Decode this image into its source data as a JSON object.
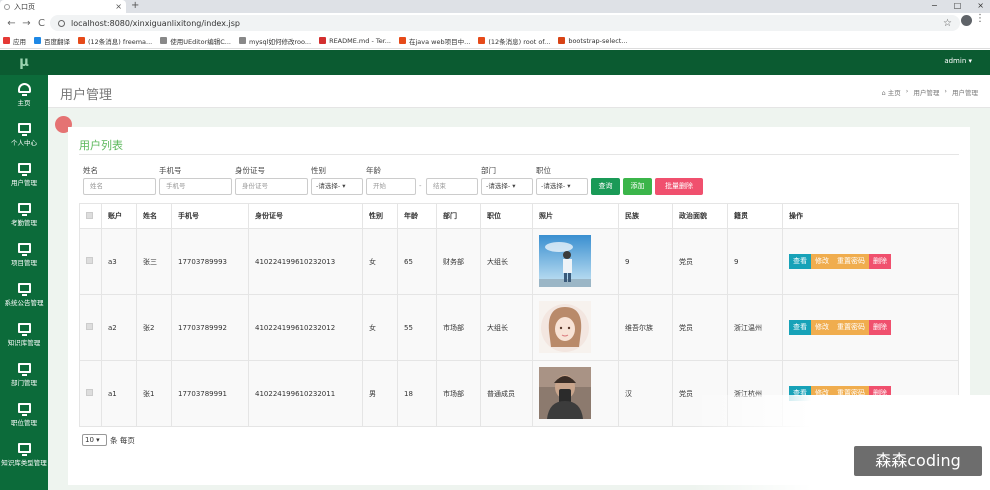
{
  "browser": {
    "tab_title": "入口页",
    "tab_close": "×",
    "new_tab": "+",
    "window_controls": [
      "−",
      "□",
      "×"
    ],
    "nav": [
      "←",
      "→",
      "C"
    ],
    "url": "localhost:8080/xinxiguanlixitong/index.jsp",
    "bookmarks": [
      {
        "label": "应用",
        "color": "#e53935"
      },
      {
        "label": "百度翻译",
        "color": "#1e88e5"
      },
      {
        "label": "(12条消息) freema...",
        "color": "#e64a19"
      },
      {
        "label": "使用UEditor编辑C...",
        "color": "#888888"
      },
      {
        "label": "mysql如何修改roo...",
        "color": "#888888"
      },
      {
        "label": "README.md - Ter...",
        "color": "#d32f2f"
      },
      {
        "label": "在java web项目中...",
        "color": "#e64a19"
      },
      {
        "label": "(12条消息) root of...",
        "color": "#e64a19"
      },
      {
        "label": "bootstrap-select...",
        "color": "#d84315"
      }
    ]
  },
  "app": {
    "logo": "μ",
    "user_menu": "admin ▾",
    "sidebar": [
      {
        "label": "主页",
        "icon": "dashboard-icon"
      },
      {
        "label": "个人中心",
        "icon": "monitor-icon"
      },
      {
        "label": "用户管理",
        "icon": "monitor-icon"
      },
      {
        "label": "考勤管理",
        "icon": "monitor-icon"
      },
      {
        "label": "项目管理",
        "icon": "monitor-icon"
      },
      {
        "label": "系统公告管理",
        "icon": "monitor-icon"
      },
      {
        "label": "知识库管理",
        "icon": "monitor-icon"
      },
      {
        "label": "部门管理",
        "icon": "monitor-icon"
      },
      {
        "label": "职位管理",
        "icon": "monitor-icon"
      },
      {
        "label": "知识库类型管理",
        "icon": "monitor-icon"
      }
    ],
    "page_title": "用户管理",
    "breadcrumb": [
      "⌂ 主页",
      "›",
      "用户管理",
      "›",
      "用户管理"
    ]
  },
  "panel": {
    "title": "用户列表",
    "filters": {
      "name_label": "姓名",
      "name_placeholder": "姓名",
      "phone_label": "手机号",
      "phone_placeholder": "手机号",
      "id_label": "身份证号",
      "id_placeholder": "身份证号",
      "gender_label": "性别",
      "gender_value": "-请选择- ▾",
      "age_label": "年龄",
      "age_start": "开始",
      "age_sep": "-",
      "age_end": "结束",
      "dept_label": "部门",
      "dept_value": "-请选择- ▾",
      "position_label": "职位",
      "position_value": "-请选择- ▾",
      "query_button": "查询",
      "add_button": "添加",
      "batch_delete_button": "批量删除"
    },
    "columns": [
      "",
      "账户",
      "姓名",
      "手机号",
      "身份证号",
      "性别",
      "年龄",
      "部门",
      "职位",
      "照片",
      "民族",
      "政治面貌",
      "籍贯",
      "操作"
    ],
    "rows": [
      {
        "account": "a3",
        "name": "张三",
        "phone": "17703789993",
        "id_no": "410224199610232013",
        "gender": "女",
        "age": "65",
        "dept": "财务部",
        "position": "大组长",
        "ethnicity": "9",
        "political": "党员",
        "origin": "9"
      },
      {
        "account": "a2",
        "name": "张2",
        "phone": "17703789992",
        "id_no": "410224199610232012",
        "gender": "女",
        "age": "55",
        "dept": "市场部",
        "position": "大组长",
        "ethnicity": "维吾尔族",
        "political": "党员",
        "origin": "浙江温州"
      },
      {
        "account": "a1",
        "name": "张1",
        "phone": "17703789991",
        "id_no": "410224199610232011",
        "gender": "男",
        "age": "18",
        "dept": "市场部",
        "position": "普通成员",
        "ethnicity": "汉",
        "political": "党员",
        "origin": "浙江杭州"
      }
    ],
    "row_actions": {
      "view": "查看",
      "edit": "修改",
      "reset": "重置密码",
      "delete": "删除"
    },
    "pager": {
      "page_size": "10 ▾",
      "per_page_text": "条 每页"
    }
  },
  "watermark": "森森coding",
  "colors": {
    "brand_dark": "#0b5b31",
    "sidebar": "#0c6b3a",
    "success": "#5cb85c",
    "info": "#17a2b8",
    "warning": "#f0ad4e",
    "danger": "#f0506e"
  }
}
